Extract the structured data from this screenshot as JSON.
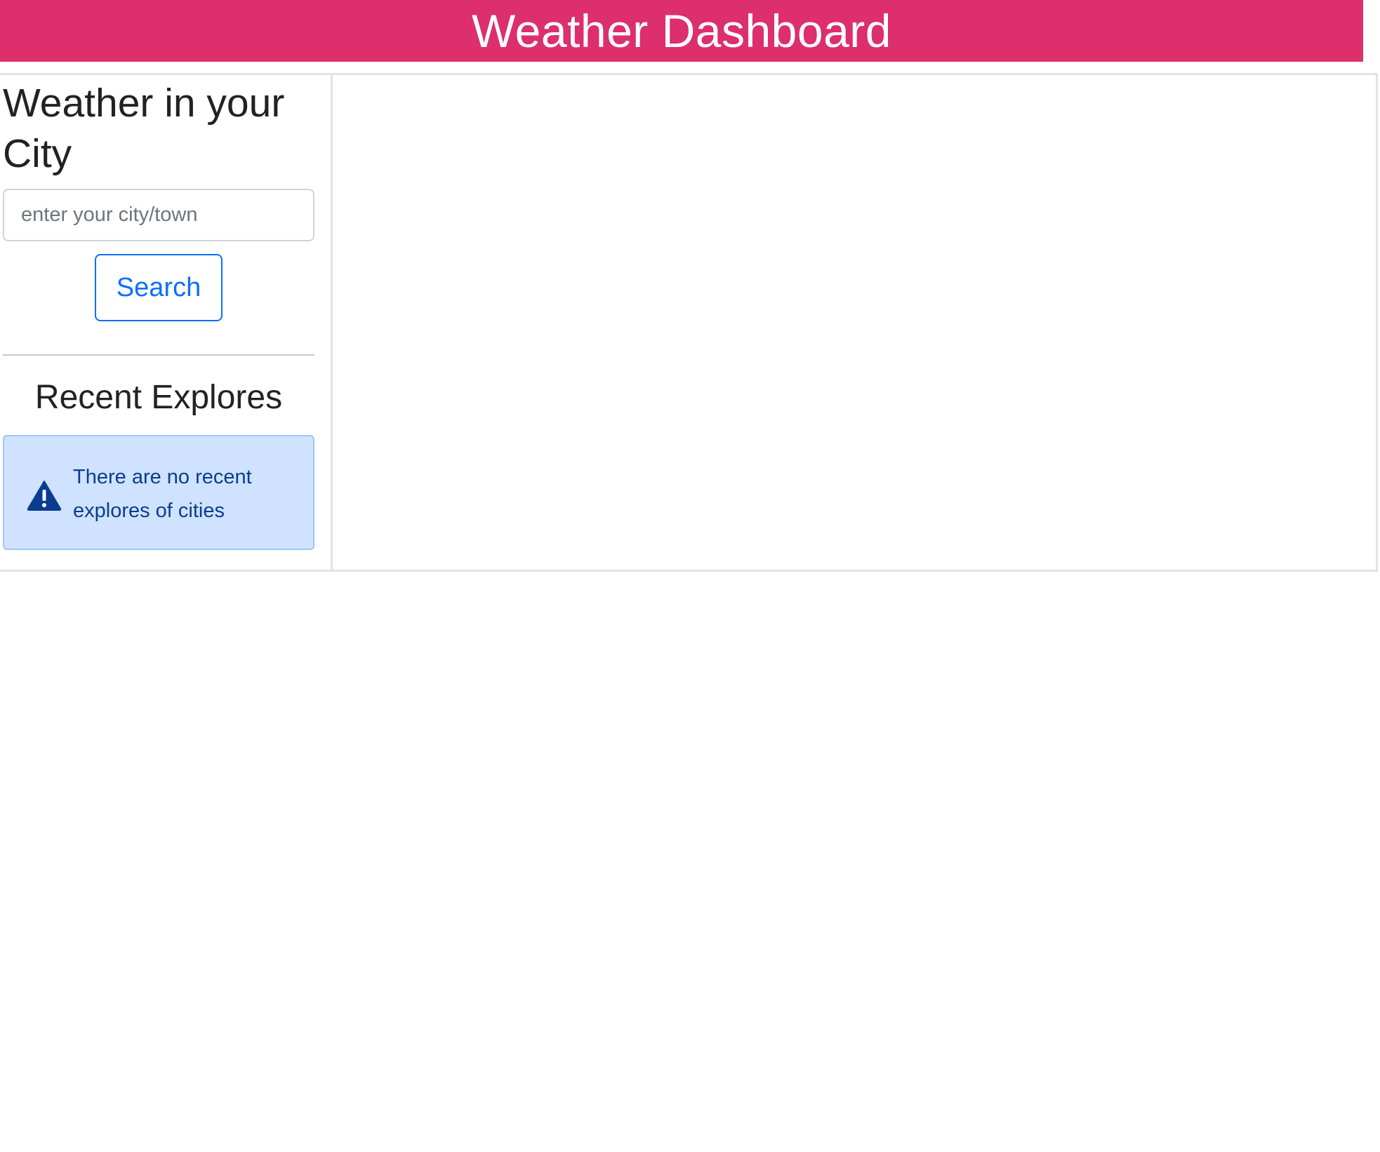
{
  "header": {
    "title": "Weather Dashboard",
    "background_color": "#dc2f6b"
  },
  "sidebar": {
    "title": "Weather in your City",
    "search_input": {
      "placeholder": "enter your city/town",
      "value": ""
    },
    "search_button_label": "Search",
    "recent_title": "Recent Explores",
    "alert": {
      "icon": "warning-triangle-icon",
      "message": "There are no recent explores of cities",
      "background_color": "#cfe2ff",
      "text_color": "#0a3d91"
    }
  },
  "accent_color": "#0d6efd"
}
